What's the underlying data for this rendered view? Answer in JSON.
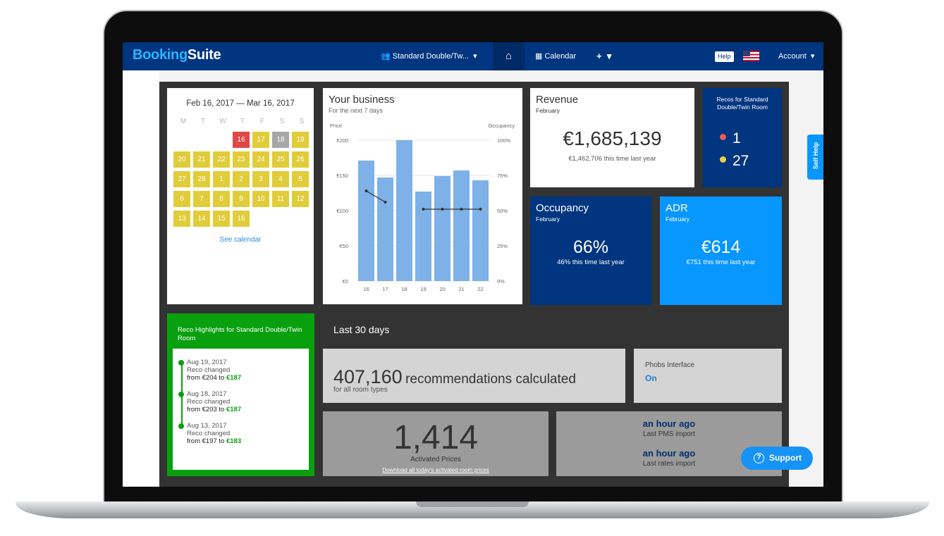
{
  "brand": {
    "part1": "Booking",
    "part2": "Suite"
  },
  "nav": {
    "room_selector": "Standard Double/Tw...",
    "calendar": "Calendar",
    "add": "+",
    "help": "Help",
    "account": "Account"
  },
  "calendar": {
    "range": "Feb 16, 2017 — Mar 16, 2017",
    "weekdays": [
      "M",
      "T",
      "W",
      "T",
      "F",
      "S",
      "S"
    ],
    "days": [
      {
        "label": "",
        "status": "empty"
      },
      {
        "label": "",
        "status": "empty"
      },
      {
        "label": "",
        "status": "empty"
      },
      {
        "label": "16",
        "status": "red"
      },
      {
        "label": "17",
        "status": "yellow"
      },
      {
        "label": "18",
        "status": "grey"
      },
      {
        "label": "19",
        "status": "yellow"
      },
      {
        "label": "20",
        "status": "yellow"
      },
      {
        "label": "21",
        "status": "yellow"
      },
      {
        "label": "22",
        "status": "yellow"
      },
      {
        "label": "23",
        "status": "yellow"
      },
      {
        "label": "24",
        "status": "yellow"
      },
      {
        "label": "25",
        "status": "yellow"
      },
      {
        "label": "26",
        "status": "yellow"
      },
      {
        "label": "27",
        "status": "yellow"
      },
      {
        "label": "28",
        "status": "yellow"
      },
      {
        "label": "1",
        "status": "yellow"
      },
      {
        "label": "2",
        "status": "yellow"
      },
      {
        "label": "3",
        "status": "yellow"
      },
      {
        "label": "4",
        "status": "yellow"
      },
      {
        "label": "5",
        "status": "yellow"
      },
      {
        "label": "6",
        "status": "yellow"
      },
      {
        "label": "7",
        "status": "yellow"
      },
      {
        "label": "8",
        "status": "yellow"
      },
      {
        "label": "9",
        "status": "yellow"
      },
      {
        "label": "10",
        "status": "yellow"
      },
      {
        "label": "11",
        "status": "yellow"
      },
      {
        "label": "12",
        "status": "yellow"
      },
      {
        "label": "13",
        "status": "yellow"
      },
      {
        "label": "14",
        "status": "yellow"
      },
      {
        "label": "15",
        "status": "yellow"
      },
      {
        "label": "16",
        "status": "yellow"
      }
    ],
    "link": "See calendar"
  },
  "business": {
    "title": "Your business",
    "subtitle": "For the next 7 days"
  },
  "chart_data": {
    "type": "bar",
    "ylabel": "Price",
    "y2label": "Occupancy",
    "categories": [
      "16",
      "17",
      "18",
      "19",
      "20",
      "21",
      "22"
    ],
    "yticks": [
      "€200",
      "€150",
      "€100",
      "€50",
      "€0"
    ],
    "y2ticks": [
      "100%",
      "75%",
      "50%",
      "25%",
      "0%"
    ],
    "ylim": [
      0,
      200
    ],
    "y2lim": [
      0,
      100
    ],
    "series": [
      {
        "kind": "bar",
        "values": [
          171,
          147,
          200,
          127,
          149,
          157,
          143
        ]
      },
      {
        "kind": "line",
        "values": [
          64,
          56,
          null,
          51,
          51,
          51,
          51
        ]
      }
    ],
    "grid": true,
    "bar_color": "#7db1e8",
    "line_color": "#333333"
  },
  "revenue": {
    "title": "Revenue",
    "period": "February",
    "value": "€1,685,139",
    "last_year": "€1,462,706 this time last year"
  },
  "recos": {
    "title": "Recos for Standard Double/Twin Room",
    "red_count": "1",
    "yellow_count": "27"
  },
  "occupancy": {
    "title": "Occupancy",
    "period": "February",
    "value": "66%",
    "last_year": "46% this time last year"
  },
  "adr": {
    "title": "ADR",
    "period": "February",
    "value": "€614",
    "last_year": "€751 this time last year"
  },
  "highlights": {
    "title": "Reco Highlights for Standard Double/Twin Room",
    "items": [
      {
        "date": "Aug 19, 2017",
        "label": "Reco changed",
        "from_text": "from €204 to",
        "new_price": "€187"
      },
      {
        "date": "Aug 18, 2017",
        "label": "Reco changed",
        "from_text": "from €203 to",
        "new_price": "€187"
      },
      {
        "date": "Aug 13, 2017",
        "label": "Reco changed",
        "from_text": "from €197 to",
        "new_price": "€183"
      }
    ]
  },
  "last30": {
    "heading": "Last 30 days",
    "recs_value": "407,160",
    "recs_text": "recommendations calculated",
    "recs_sub": "for all room types",
    "phobs_title": "Phobs Interface",
    "phobs_status": "On",
    "activated_value": "1,414",
    "activated_label": "Activated Prices",
    "activated_link": "Download all today's activated room prices",
    "pms_time": "an hour ago",
    "pms_label": "Last PMS import",
    "rates_time": "an hour ago",
    "rates_label": "Last rates import"
  },
  "self_help": "Self Help",
  "support": {
    "label": "Support",
    "icon": "?"
  },
  "colors": {
    "navy": "#003580",
    "sky": "#0896ff",
    "green": "#09a00f",
    "calendar_yellow": "#e1cc3a",
    "calendar_red": "#e04848"
  }
}
